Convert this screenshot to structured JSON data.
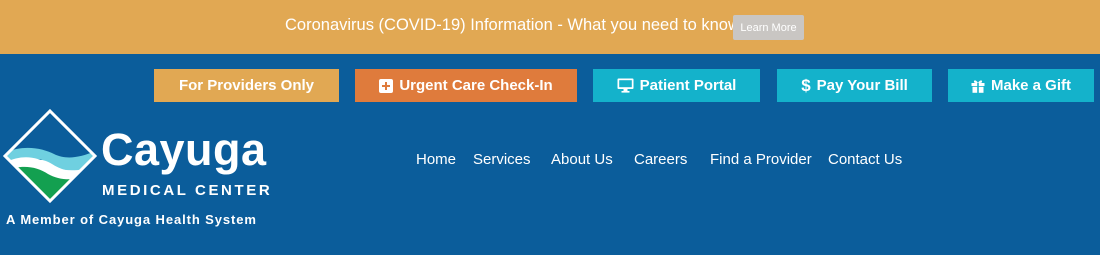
{
  "alert": {
    "message": "Coronavirus (COVID-19) Information - What you need to know",
    "learn_more_label": "Learn More"
  },
  "top_buttons": {
    "providers": "For Providers Only",
    "urgent_care": "Urgent Care Check-In",
    "patient_portal": "Patient Portal",
    "pay_bill": "Pay Your Bill",
    "make_gift": "Make a Gift"
  },
  "icons": {
    "urgent_care": "plus-square-icon",
    "patient_portal": "monitor-icon",
    "pay_bill": "dollar-icon",
    "make_gift": "gift-icon",
    "pay_bill_glyph": "$"
  },
  "logo": {
    "name": "Cayuga",
    "subtitle": "MEDICAL CENTER",
    "tagline": "A Member of Cayuga Health System"
  },
  "nav": [
    {
      "label": "Home"
    },
    {
      "label": "Services"
    },
    {
      "label": "About Us"
    },
    {
      "label": "Careers"
    },
    {
      "label": "Find a Provider"
    },
    {
      "label": "Contact Us"
    }
  ],
  "colors": {
    "header_bg": "#0b5d9b",
    "alert_bg": "#e1a853",
    "providers_btn": "#e1a853",
    "urgent_btn": "#df7b3c",
    "teal_btn": "#14b2cb",
    "learn_more_btn": "#c9c6c3"
  }
}
